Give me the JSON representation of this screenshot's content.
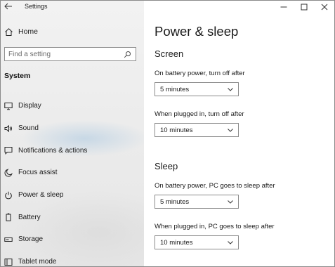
{
  "window": {
    "title": "Settings"
  },
  "sidebar": {
    "home_label": "Home",
    "search_placeholder": "Find a setting",
    "section_label": "System",
    "items": [
      {
        "label": "Display",
        "icon": "display-icon"
      },
      {
        "label": "Sound",
        "icon": "speaker-icon"
      },
      {
        "label": "Notifications & actions",
        "icon": "notification-icon"
      },
      {
        "label": "Focus assist",
        "icon": "moon-icon"
      },
      {
        "label": "Power & sleep",
        "icon": "power-icon"
      },
      {
        "label": "Battery",
        "icon": "battery-icon"
      },
      {
        "label": "Storage",
        "icon": "storage-icon"
      },
      {
        "label": "Tablet mode",
        "icon": "tablet-icon"
      }
    ]
  },
  "main": {
    "page_title": "Power & sleep",
    "screen": {
      "title": "Screen",
      "battery_label": "On battery power, turn off after",
      "battery_value": "5 minutes",
      "plugged_label": "When plugged in, turn off after",
      "plugged_value": "10 minutes"
    },
    "sleep": {
      "title": "Sleep",
      "battery_label": "On battery power, PC goes to sleep after",
      "battery_value": "5 minutes",
      "plugged_label": "When plugged in, PC goes to sleep after",
      "plugged_value": "10 minutes"
    }
  }
}
